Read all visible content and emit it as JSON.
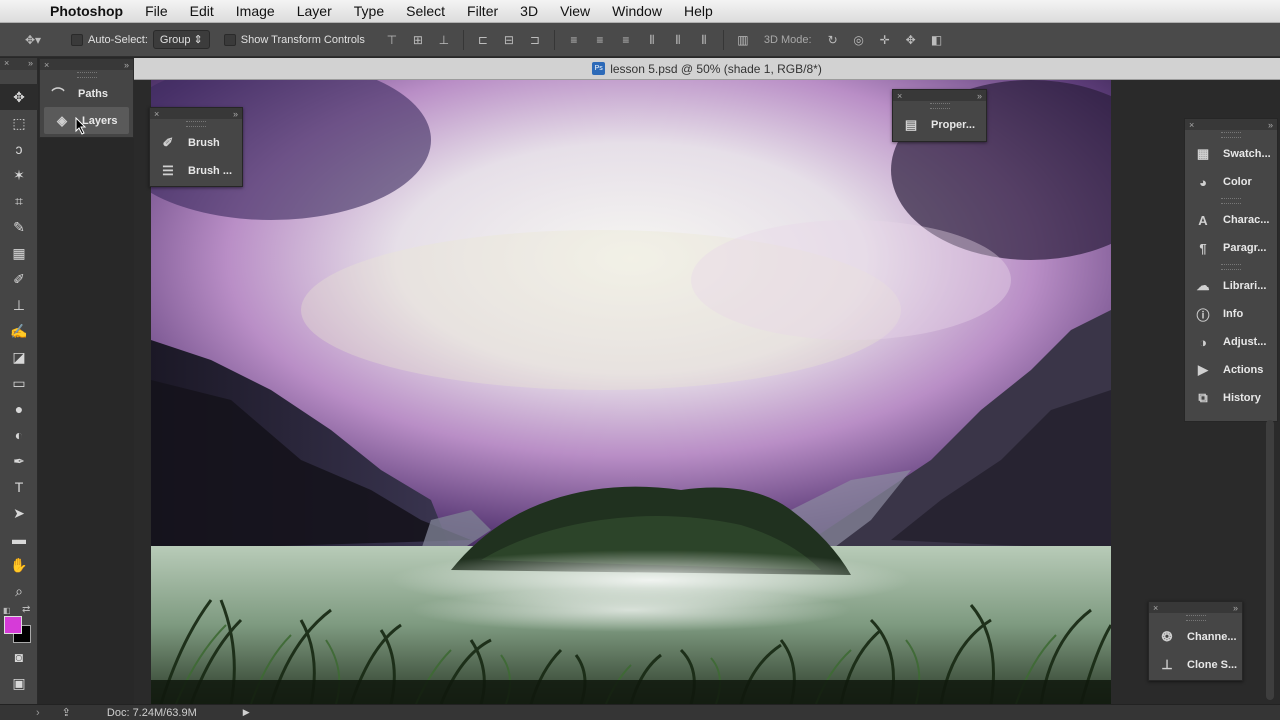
{
  "menubar": {
    "app": "Photoshop",
    "items": [
      "File",
      "Edit",
      "Image",
      "Layer",
      "Type",
      "Select",
      "Filter",
      "3D",
      "View",
      "Window",
      "Help"
    ]
  },
  "options": {
    "auto_select_label": "Auto-Select:",
    "auto_select_value": "Group",
    "transform_label": "Show Transform Controls",
    "mode_label": "3D Mode:"
  },
  "left_panel": {
    "items": [
      {
        "label": "Paths",
        "icon": "paths-icon"
      },
      {
        "label": "Layers",
        "icon": "layers-icon"
      }
    ]
  },
  "brush_panel": {
    "items": [
      {
        "label": "Brush",
        "icon": "brush-icon"
      },
      {
        "label": "Brush ...",
        "icon": "brush-presets-icon"
      }
    ]
  },
  "properties_panel": {
    "label": "Proper..."
  },
  "document": {
    "title": "lesson 5.psd @ 50% (shade 1, RGB/8*)"
  },
  "right_dock": {
    "groups": [
      [
        {
          "label": "Swatch...",
          "icon": "swatches-icon"
        },
        {
          "label": "Color",
          "icon": "color-icon"
        }
      ],
      [
        {
          "label": "Charac...",
          "icon": "character-icon"
        },
        {
          "label": "Paragr...",
          "icon": "paragraph-icon"
        }
      ],
      [
        {
          "label": "Librari...",
          "icon": "libraries-icon"
        },
        {
          "label": "Info",
          "icon": "info-icon"
        },
        {
          "label": "Adjust...",
          "icon": "adjustments-icon"
        },
        {
          "label": "Actions",
          "icon": "actions-icon"
        },
        {
          "label": "History",
          "icon": "history-icon"
        }
      ]
    ]
  },
  "channels_panel": {
    "items": [
      {
        "label": "Channe...",
        "icon": "channels-icon"
      },
      {
        "label": "Clone S...",
        "icon": "clone-source-icon"
      }
    ]
  },
  "status": {
    "doc_info": "Doc: 7.24M/63.9M"
  },
  "colors": {
    "foreground": "#d63bd8",
    "background": "#000000",
    "accent": "#2d6ab8"
  }
}
